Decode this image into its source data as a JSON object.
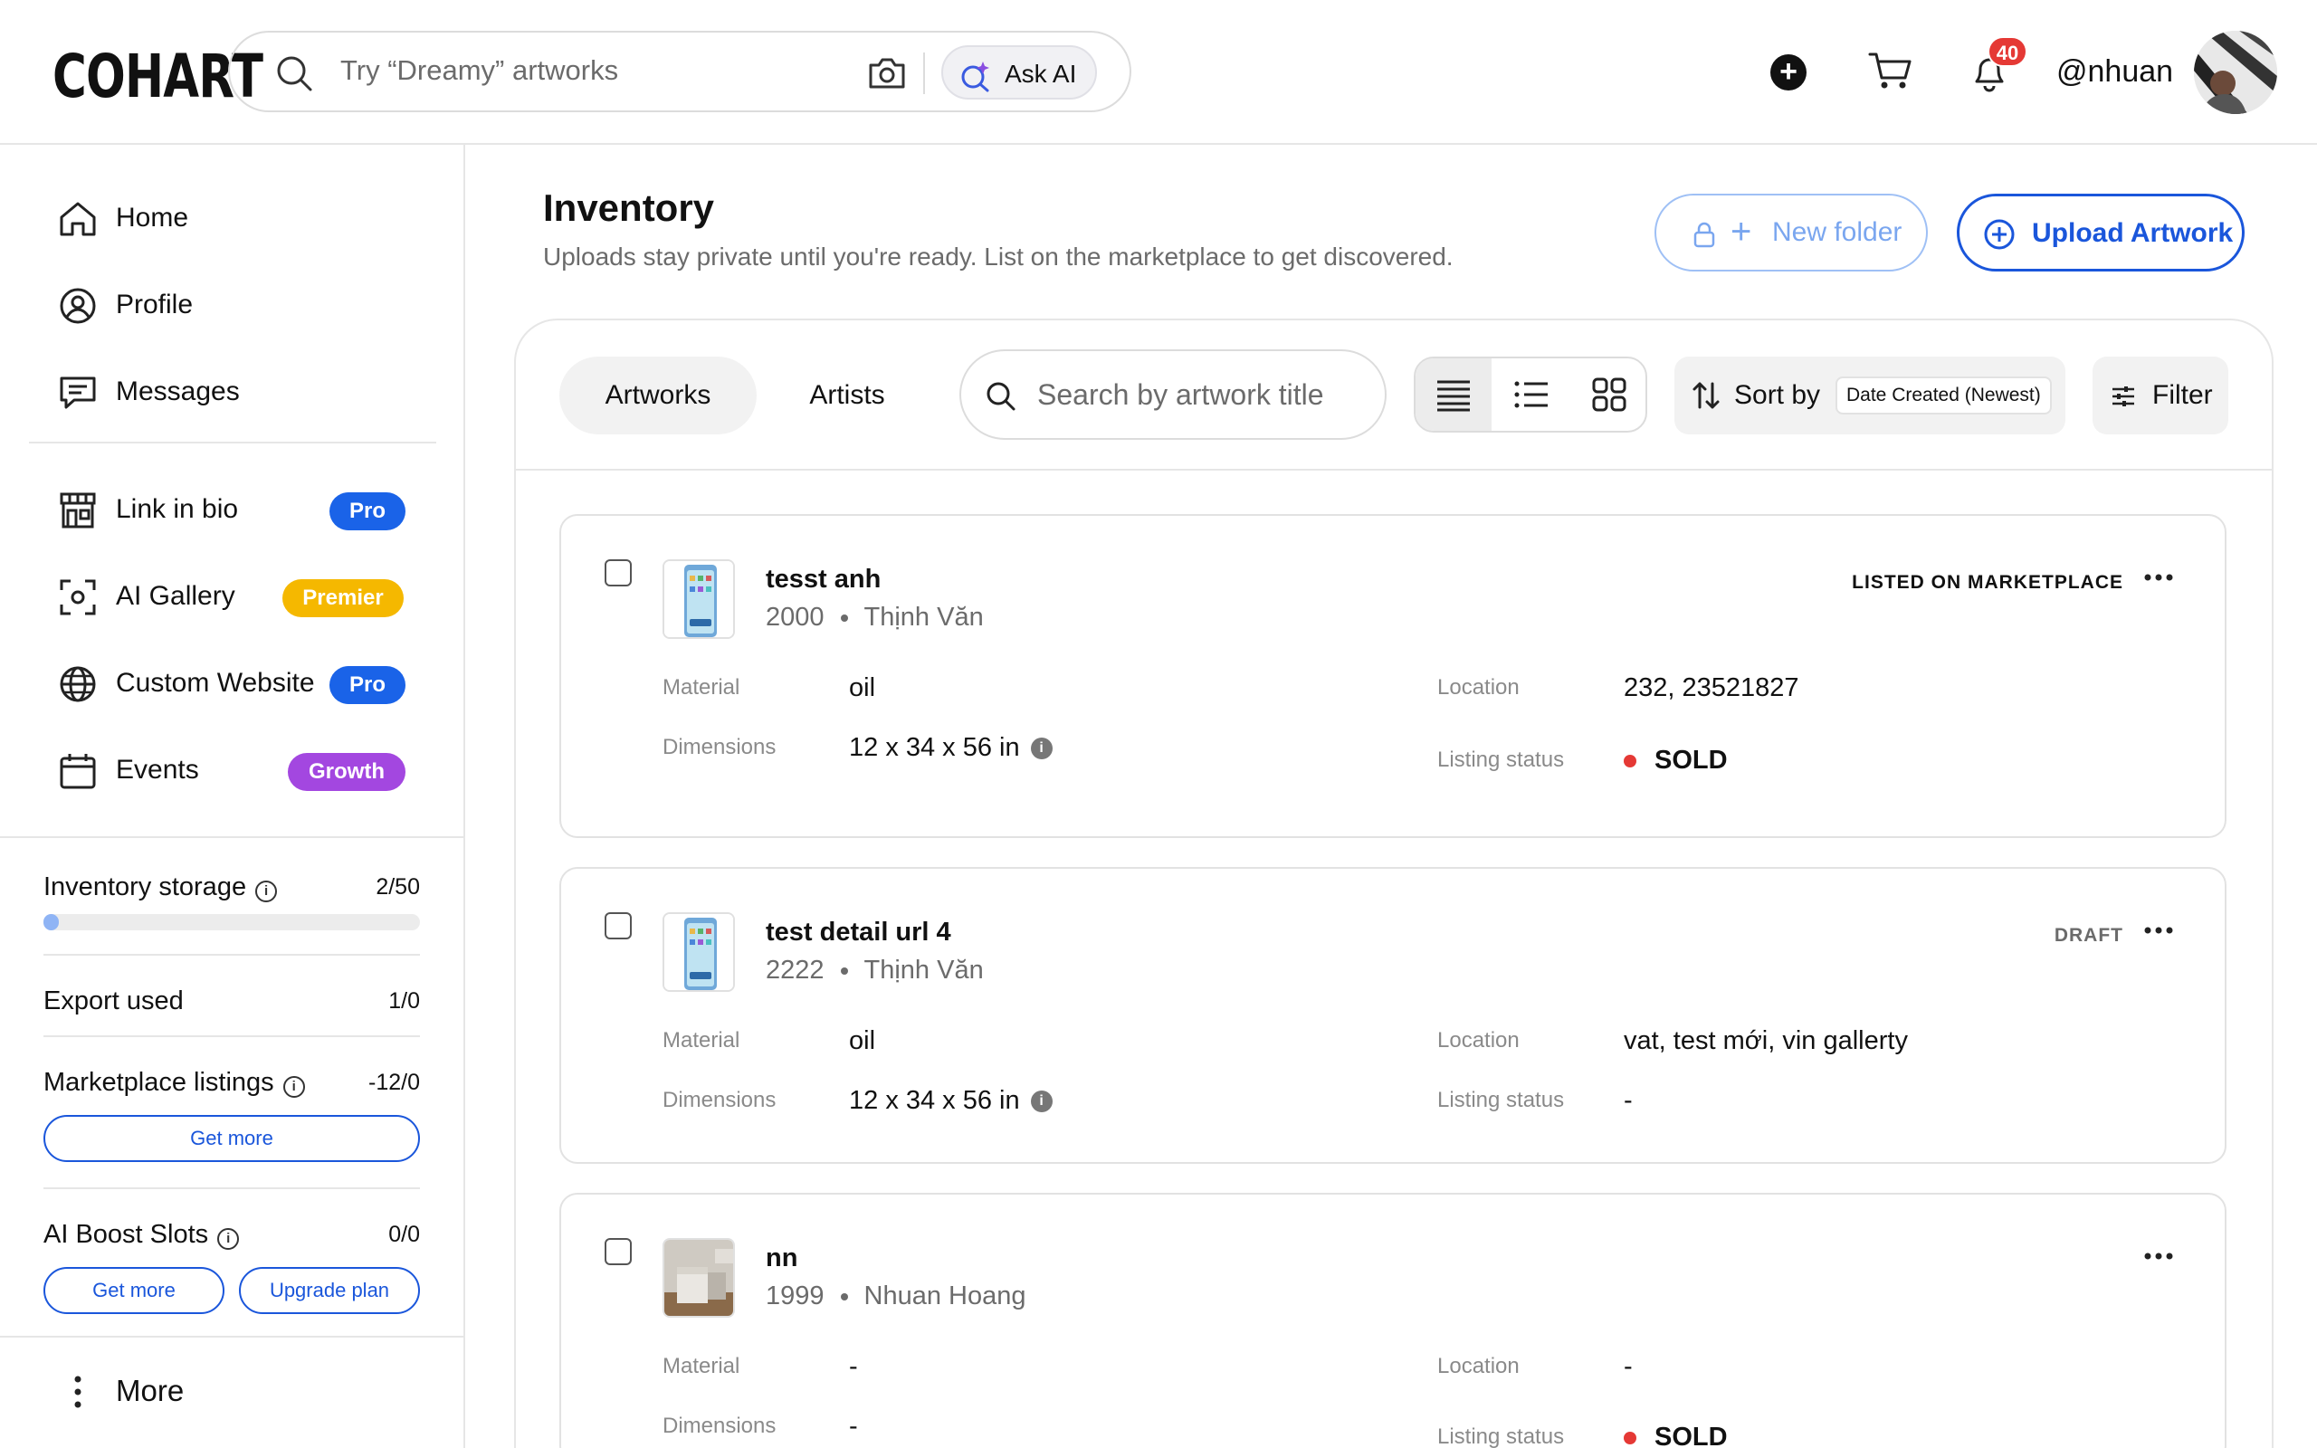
{
  "brand": {
    "logo": "COHART"
  },
  "header": {
    "search_placeholder": "Try “Dreamy” artworks",
    "ask_ai_label": "Ask AI",
    "notification_count": "40",
    "username": "@nhuan"
  },
  "sidebar": {
    "nav": [
      {
        "label": "Home",
        "icon": "home-icon"
      },
      {
        "label": "Profile",
        "icon": "user-circle-icon"
      },
      {
        "label": "Messages",
        "icon": "message-icon"
      }
    ],
    "features": [
      {
        "label": "Link in bio",
        "icon": "storefront-icon",
        "badge": "Pro",
        "badge_color": "#1a63e8"
      },
      {
        "label": "AI Gallery",
        "icon": "scan-icon",
        "badge": "Premier",
        "badge_color": "#f5b800"
      },
      {
        "label": "Custom Website",
        "icon": "globe-icon",
        "badge": "Pro",
        "badge_color": "#1a63e8"
      },
      {
        "label": "Events",
        "icon": "calendar-icon",
        "badge": "Growth",
        "badge_color": "#a347e0"
      }
    ],
    "quotas": {
      "inventory_storage": {
        "label": "Inventory storage",
        "value": "2/50",
        "progress": 0.04
      },
      "export_used": {
        "label": "Export used",
        "value": "1/0"
      },
      "marketplace_listings": {
        "label": "Marketplace listings",
        "value": "-12/0",
        "button": "Get more"
      },
      "ai_boost_slots": {
        "label": "AI Boost Slots",
        "value": "0/0",
        "button_get_more": "Get more",
        "button_upgrade": "Upgrade plan"
      }
    },
    "more_label": "More"
  },
  "main": {
    "title": "Inventory",
    "subtitle": "Uploads stay private until you're ready. List on the marketplace to get discovered.",
    "new_folder_label": "New folder",
    "upload_label": "Upload Artwork",
    "tabs": [
      {
        "label": "Artworks",
        "active": true
      },
      {
        "label": "Artists",
        "active": false
      }
    ],
    "search_placeholder": "Search by artwork title",
    "view_mode": "detail-list",
    "sort_label": "Sort by",
    "sort_value": "Date Created (Newest)",
    "filter_label": "Filter",
    "field_labels": {
      "material": "Material",
      "dimensions": "Dimensions",
      "location": "Location",
      "listing_status": "Listing status"
    },
    "artworks": [
      {
        "title": "tesst anh",
        "year": "2000",
        "artist": "Thịnh Văn",
        "status": "LISTED ON MARKETPLACE",
        "material": "oil",
        "dimensions": "12 x 34 x 56 in",
        "location": "232, 23521827",
        "listing_status": "SOLD",
        "sold": true,
        "thumb": "phone"
      },
      {
        "title": "test detail url 4",
        "year": "2222",
        "artist": "Thịnh Văn",
        "status": "DRAFT",
        "material": "oil",
        "dimensions": "12 x 34 x 56 in",
        "location": "vat, test mới, vin gallerty",
        "listing_status": "-",
        "sold": false,
        "thumb": "phone"
      },
      {
        "title": "nn",
        "year": "1999",
        "artist": "Nhuan Hoang",
        "status": "",
        "material": "-",
        "dimensions": "-",
        "location": "-",
        "listing_status": "SOLD",
        "sold": true,
        "thumb": "photo"
      }
    ]
  },
  "colors": {
    "accent": "#1a56db",
    "sold": "#e53935",
    "badge_pro": "#1a63e8",
    "badge_premier": "#f5b800",
    "badge_growth": "#a347e0"
  }
}
